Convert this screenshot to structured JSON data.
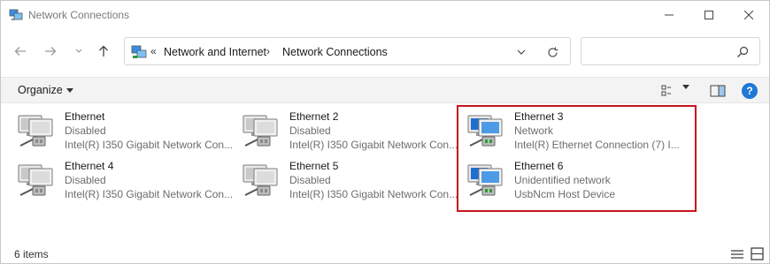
{
  "window": {
    "title": "Network Connections"
  },
  "address": {
    "overflow": "«",
    "crumbs": [
      "Network and Internet",
      "Network Connections"
    ],
    "separator": "›"
  },
  "search": {
    "placeholder": ""
  },
  "command_bar": {
    "organize_label": "Organize"
  },
  "items": [
    {
      "name": "Ethernet",
      "status": "Disabled",
      "device": "Intel(R) I350 Gigabit Network Con...",
      "state": "disabled"
    },
    {
      "name": "Ethernet 2",
      "status": "Disabled",
      "device": "Intel(R) I350 Gigabit Network Con...",
      "state": "disabled"
    },
    {
      "name": "Ethernet 3",
      "status": "Network",
      "device": "Intel(R) Ethernet Connection (7) I...",
      "state": "connected"
    },
    {
      "name": "Ethernet 4",
      "status": "Disabled",
      "device": "Intel(R) I350 Gigabit Network Con...",
      "state": "disabled"
    },
    {
      "name": "Ethernet 5",
      "status": "Disabled",
      "device": "Intel(R) I350 Gigabit Network Con...",
      "state": "disabled"
    },
    {
      "name": "Ethernet 6",
      "status": "Unidentified network",
      "device": "UsbNcm Host Device",
      "state": "connected"
    }
  ],
  "status_bar": {
    "item_count": "6 items"
  },
  "colors": {
    "highlight_border": "#c8141e",
    "help_icon": "#1e78d4",
    "connected_screen": "#1f6fd0"
  }
}
